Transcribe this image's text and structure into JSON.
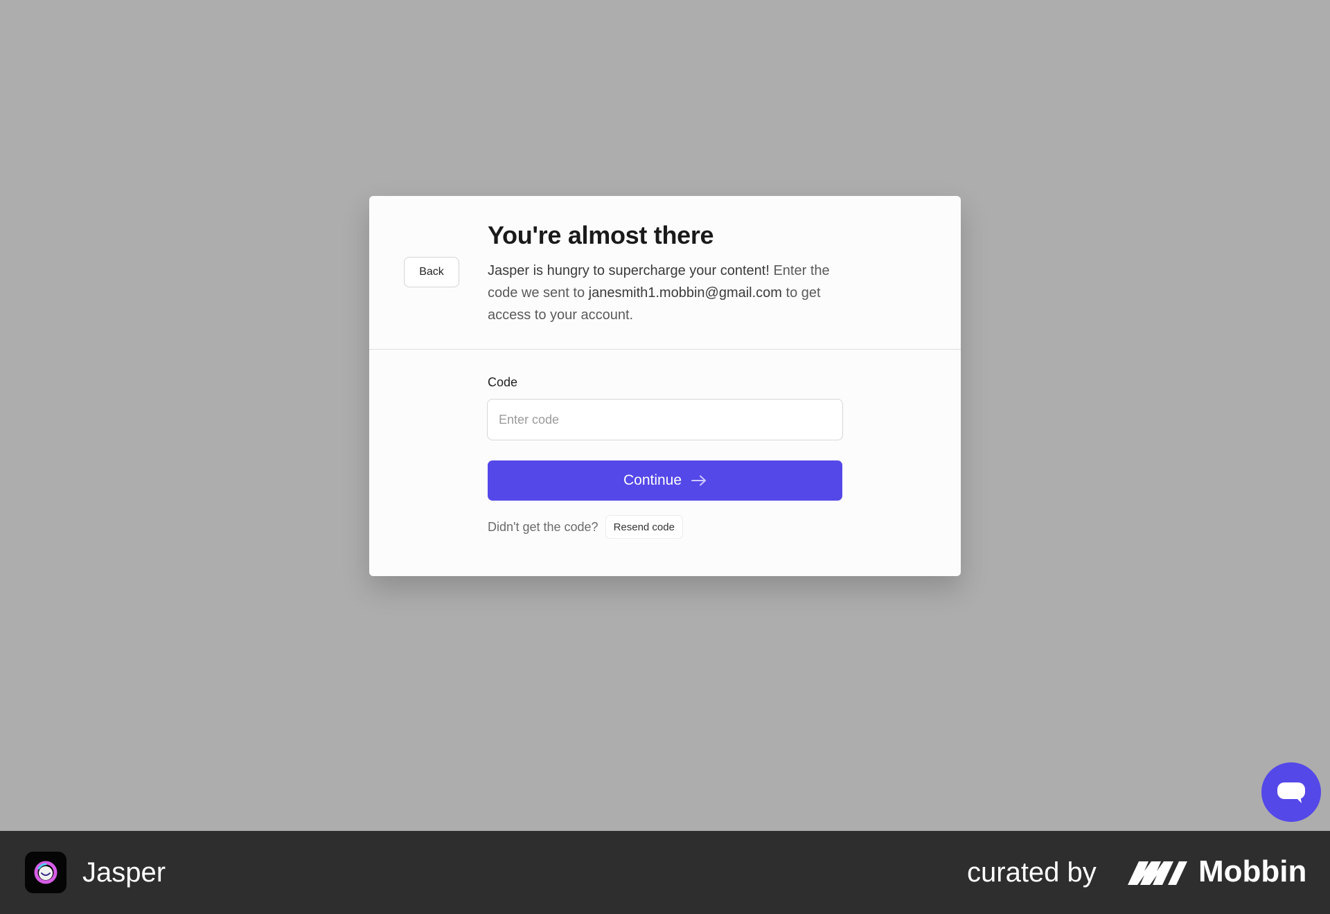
{
  "modal": {
    "back_label": "Back",
    "title": "You're almost there",
    "subtitle": {
      "lead": "Jasper is hungry to supercharge your content!",
      "part2": " Enter the code we sent to ",
      "email": "janesmith1.mobbin@gmail.com",
      "part3": " to get access to your account."
    },
    "code_label": "Code",
    "code_placeholder": "Enter code",
    "code_value": "",
    "continue_label": "Continue",
    "resend_prompt": "Didn't get the code?",
    "resend_label": "Resend code"
  },
  "footer": {
    "app_name": "Jasper",
    "curated_by": "curated by",
    "brand": "Mobbin"
  },
  "colors": {
    "accent": "#5548e8",
    "backdrop": "#adadad",
    "footer_bg": "#2e2e2e"
  },
  "icons": {
    "continue": "arrow-right-icon",
    "chat": "chat-bubble-icon",
    "app": "jasper-logo-icon",
    "brand": "mobbin-logo-icon"
  }
}
